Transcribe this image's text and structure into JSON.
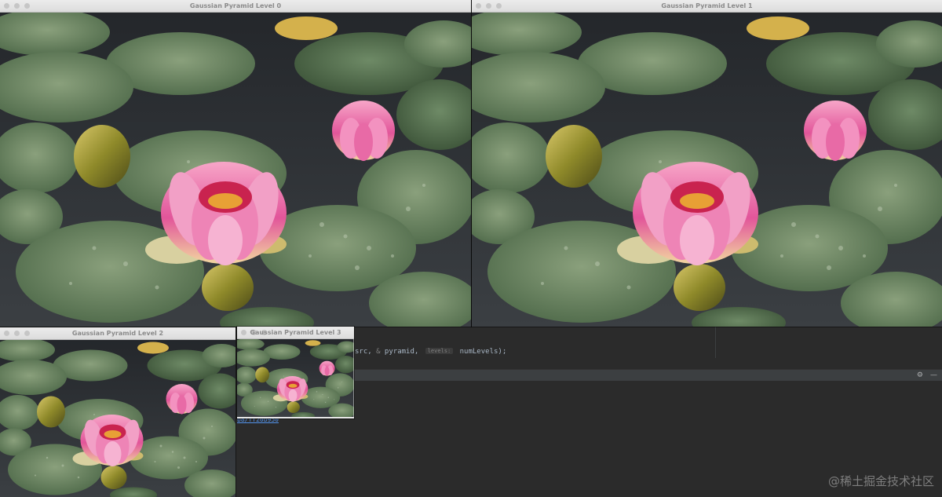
{
  "windows": [
    {
      "title": "Gaussian Pyramid Level 0"
    },
    {
      "title": "Gaussian Pyramid Level 1"
    },
    {
      "title": "Gaussian Pyramid Level 2"
    },
    {
      "title": "Gaussian Pyramid Level 3"
    }
  ],
  "editor": {
    "code_start": "src, ",
    "amp": "&",
    "code_mid": " pyramid, ",
    "hint": "levels:",
    "code_end": " numLevels);"
  },
  "panel": {
    "settings_icon": "gear-icon",
    "minimize_icon": "minimize-icon"
  },
  "console": {
    "link_text": "b8/ff20b950"
  },
  "watermark": "@稀土掘金技术社区",
  "colors": {
    "ide_bg": "#2b2b2b",
    "panel_bg": "#3c3f41",
    "window_title": "#8a8a8a",
    "water": "#2f3236",
    "lily_pad": "#5e7a58",
    "lotus_pink": "#e0609c"
  }
}
